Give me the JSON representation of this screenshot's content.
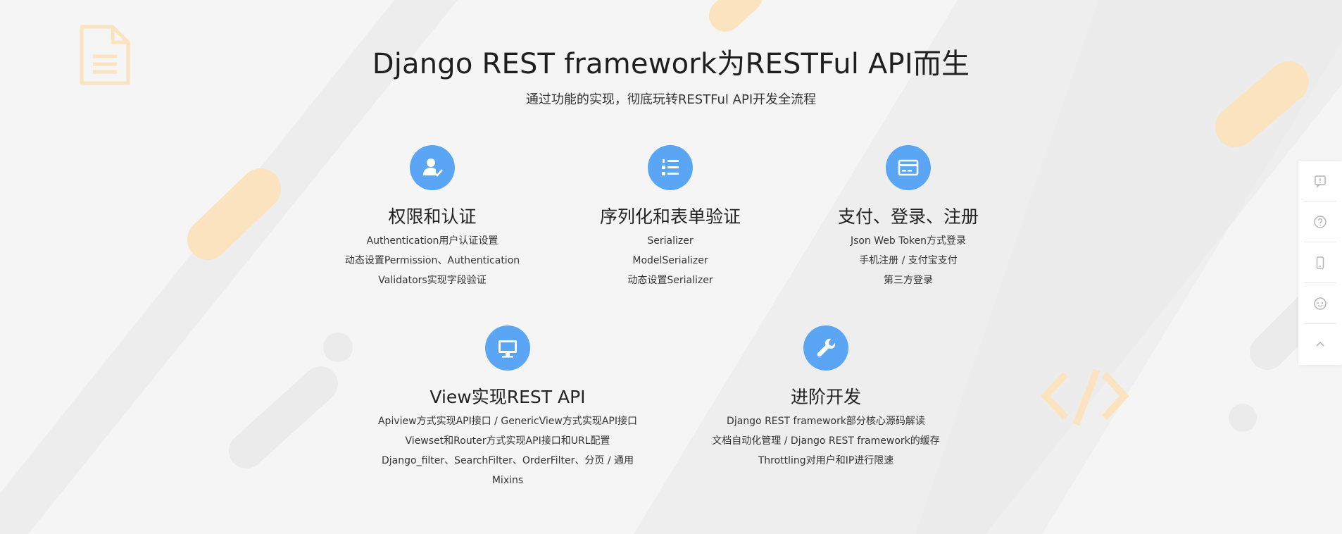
{
  "header": {
    "title": "Django REST framework为RESTFul API而生",
    "subtitle": "通过功能的实现，彻底玩转RESTFul API开发全流程"
  },
  "features": [
    {
      "icon": "user-check-icon",
      "title": "权限和认证",
      "lines": [
        "Authentication用户认证设置",
        "动态设置Permission、Authentication",
        "Validators实现字段验证"
      ]
    },
    {
      "icon": "numbered-list-icon",
      "title": "序列化和表单验证",
      "lines": [
        "Serializer",
        "ModelSerializer",
        "动态设置Serializer"
      ]
    },
    {
      "icon": "credit-card-icon",
      "title": "支付、登录、注册",
      "lines": [
        "Json Web Token方式登录",
        "手机注册 / 支付宝支付",
        "第三方登录"
      ]
    },
    {
      "icon": "monitor-icon",
      "title": "View实现REST API",
      "lines": [
        "Apiview方式实现API接口 / GenericView方式实现API接口",
        "Viewset和Router方式实现API接口和URL配置",
        "Django_filter、SearchFilter、OrderFilter、分页 / 通用Mixins"
      ]
    },
    {
      "icon": "wrench-icon",
      "title": "进阶开发",
      "lines": [
        "Django REST framework部分核心源码解读",
        "文档自动化管理 / Django REST framework的缓存",
        "Throttling对用户和IP进行限速"
      ]
    }
  ],
  "sidebar": {
    "items": [
      "feedback-icon",
      "help-icon",
      "mobile-icon",
      "chat-icon",
      "back-to-top-icon"
    ]
  },
  "colors": {
    "accent": "#5aa6f5",
    "decor_orange": "#fbe3bf",
    "decor_gray": "#ebebeb",
    "background": "#f5f5f5"
  }
}
